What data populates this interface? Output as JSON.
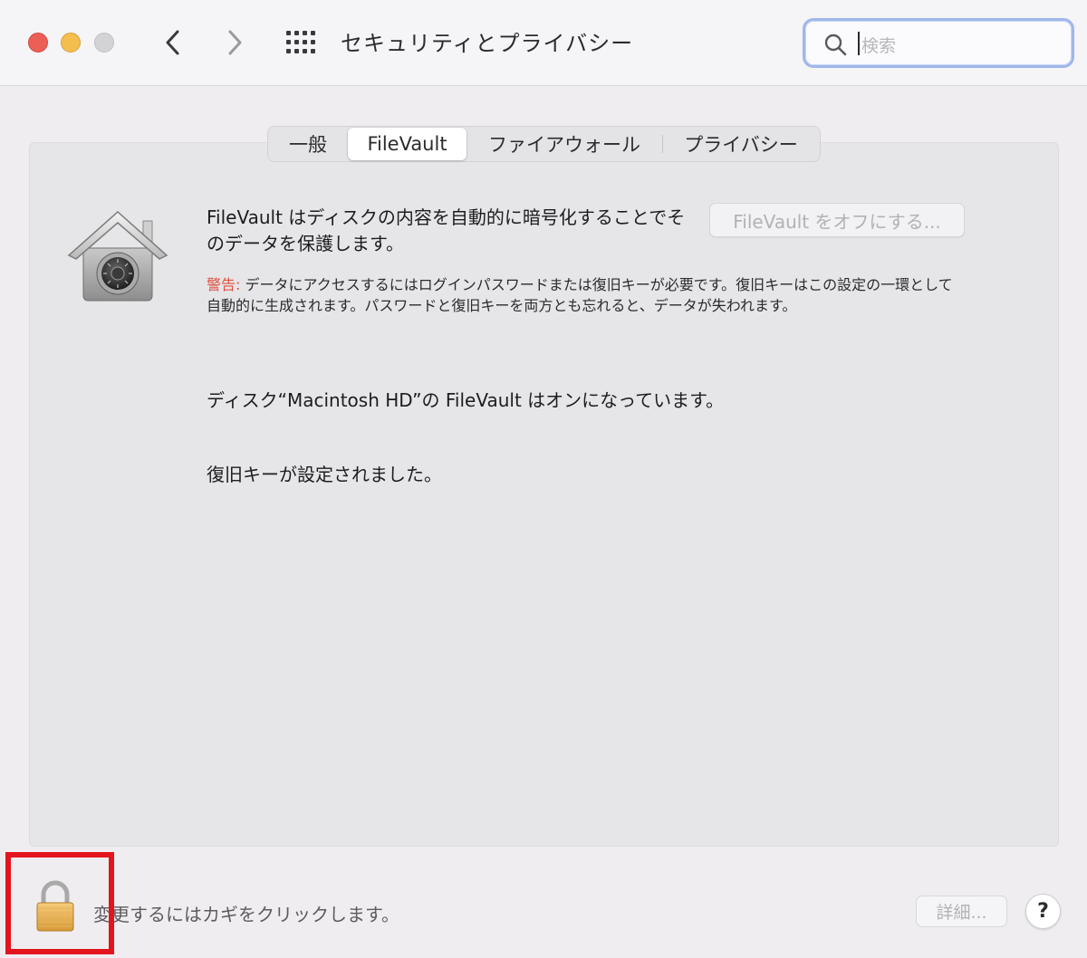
{
  "window": {
    "title": "セキュリティとプライバシー"
  },
  "search": {
    "placeholder": "検索"
  },
  "tabs": [
    {
      "label": "一般",
      "selected": false
    },
    {
      "label": "FileVault",
      "selected": true
    },
    {
      "label": "ファイアウォール",
      "selected": false
    },
    {
      "label": "プライバシー",
      "selected": false
    }
  ],
  "filevault": {
    "description": "FileVault はディスクの内容を自動的に暗号化することでそのデータを保護します。",
    "turn_off_button": "FileVault をオフにする...",
    "warning_label": "警告:",
    "warning_text": " データにアクセスするにはログインパスワードまたは復旧キーが必要です。復旧キーはこの設定の一環として自動的に生成されます。パスワードと復旧キーを両方とも忘れると、データが失われます。",
    "status": "ディスク“Macintosh HD”の FileVault はオンになっています。",
    "recovery_status": "復旧キーが設定されました。"
  },
  "footer": {
    "lock_text": "変更するにはカギをクリックします。",
    "details_button": "詳細...",
    "help_button": "?"
  },
  "icons": {
    "back": "chevron-left-icon",
    "forward": "chevron-right-icon",
    "show_all": "grid-icon",
    "search": "search-icon",
    "filevault": "filevault-house-icon",
    "lock": "lock-icon"
  },
  "colors": {
    "close": "#ec5f57",
    "minimize": "#f4be4f",
    "zoom": "#d3d2d4",
    "warning": "#e0513e",
    "search_focus": "#9fb7eb",
    "highlight_box": "#e3141d"
  }
}
